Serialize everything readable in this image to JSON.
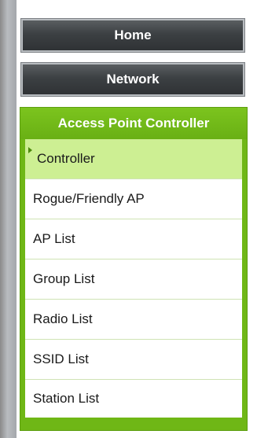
{
  "nav": {
    "home_label": "Home",
    "network_label": "Network"
  },
  "ap_controller": {
    "title": "Access Point Controller",
    "items": [
      {
        "label": "Controller",
        "active": true
      },
      {
        "label": "Rogue/Friendly AP",
        "active": false
      },
      {
        "label": "AP List",
        "active": false
      },
      {
        "label": "Group List",
        "active": false
      },
      {
        "label": "Radio List",
        "active": false
      },
      {
        "label": "SSID List",
        "active": false
      },
      {
        "label": "Station List",
        "active": false
      }
    ]
  },
  "colors": {
    "accent_green": "#6fb716",
    "active_item_bg": "#cdef93",
    "dark_button": "#3c4043"
  },
  "icons": {
    "active_indicator": "arrow-right-icon"
  }
}
